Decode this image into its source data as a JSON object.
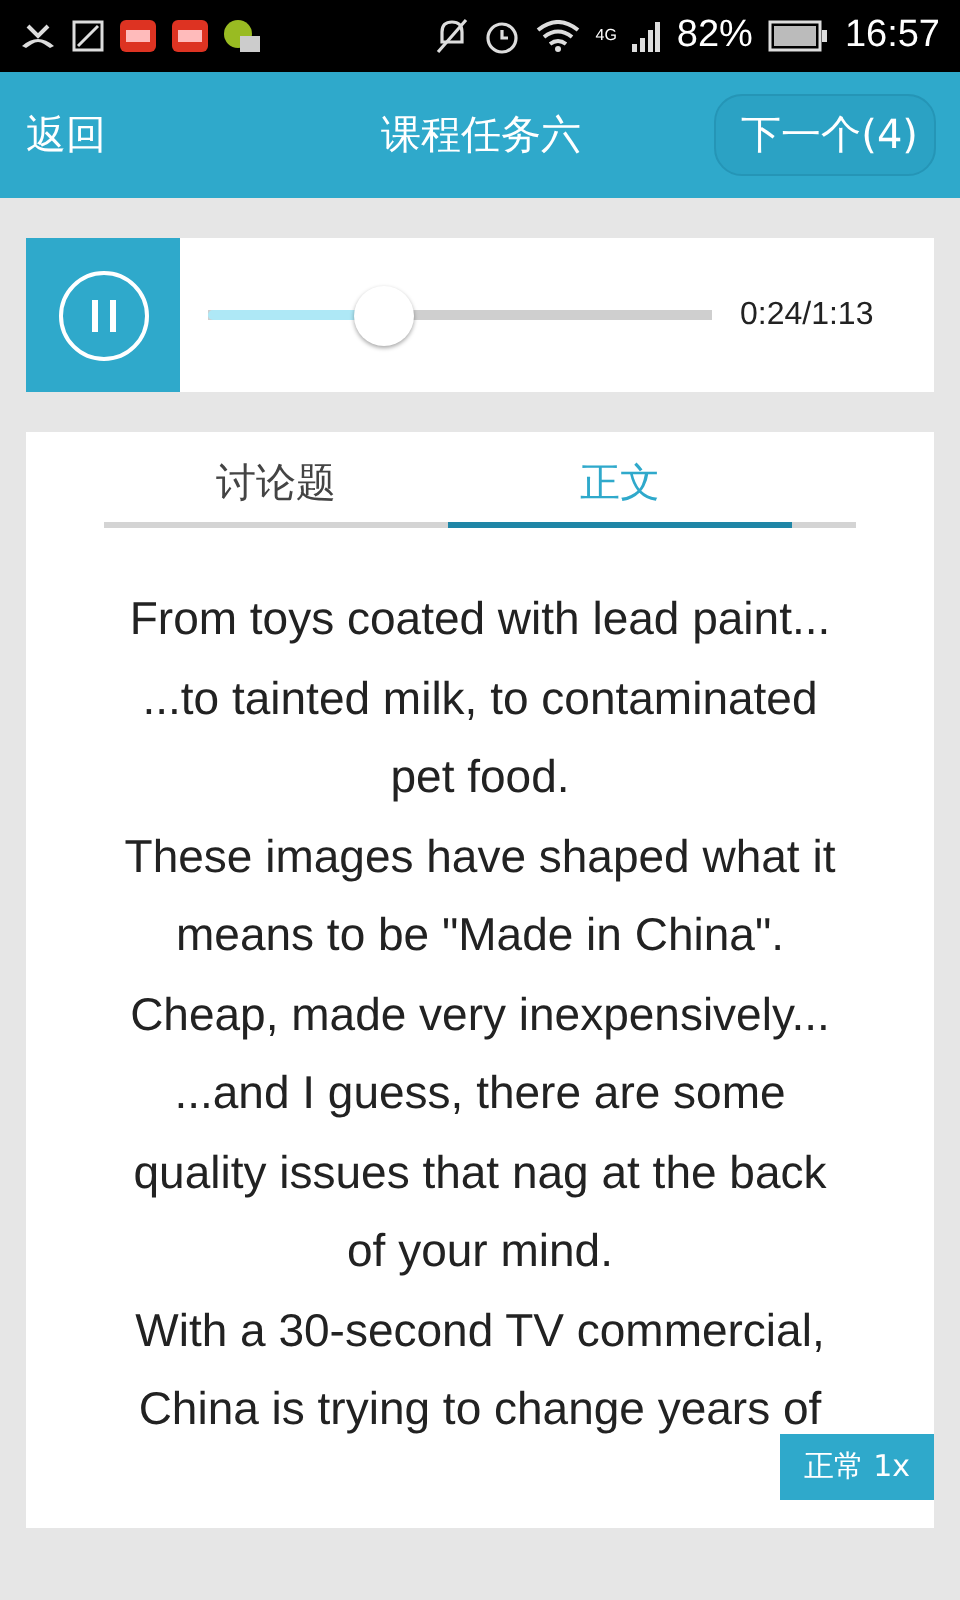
{
  "status_bar": {
    "network": "4G",
    "battery": "82%",
    "time": "16:57"
  },
  "header": {
    "back": "返回",
    "title": "课程任务六",
    "next": "下一个(4)"
  },
  "player": {
    "playing": true,
    "level": 0.35,
    "time": "0:24/1:13"
  },
  "tabs": [
    {
      "label": "讨论题",
      "selected": false
    },
    {
      "label": "正文",
      "selected": true
    }
  ],
  "transcript": [
    "From toys coated with lead paint...",
    "...to tainted milk, to contaminated pet food.",
    "These images have shaped what it means to be \"Made in China\".",
    "Cheap, made very inexpensively...",
    "...and I guess, there are some quality issues that nag at the back of your mind.",
    "With a 30-second TV commercial,",
    "China is trying to change years of"
  ],
  "speed_button": "正常 1x"
}
